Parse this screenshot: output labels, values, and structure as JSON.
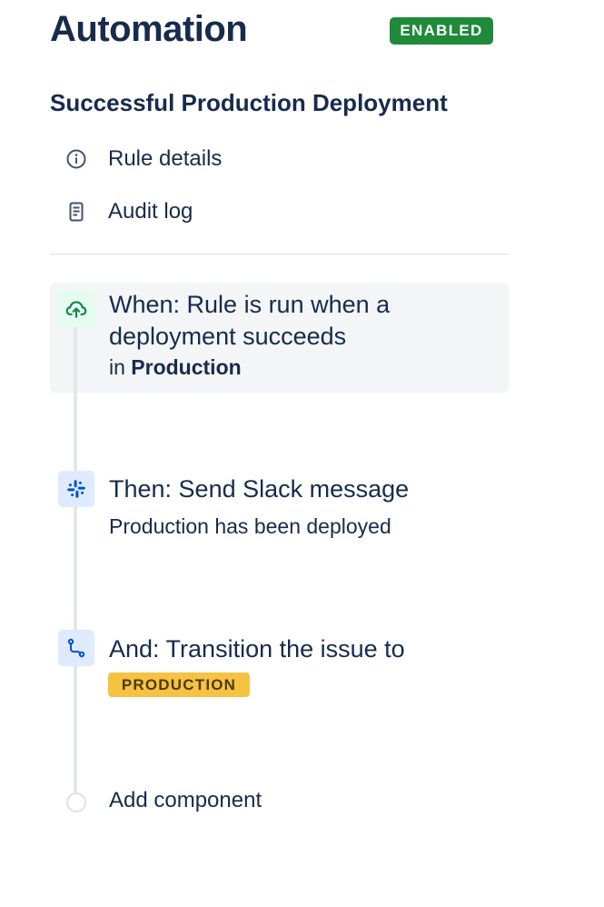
{
  "header": {
    "title": "Automation",
    "status_badge": "ENABLED"
  },
  "rule": {
    "name": "Successful Production Deployment"
  },
  "nav": [
    {
      "label": "Rule details",
      "icon": "info-icon"
    },
    {
      "label": "Audit log",
      "icon": "document-icon"
    }
  ],
  "trigger": {
    "line1": "When: Rule is run when a",
    "line2": "deployment succeeds",
    "env_prefix": "in",
    "env_name": "Production",
    "icon": "cloud-upload-icon"
  },
  "action_slack": {
    "title": "Then: Send Slack message",
    "detail": "Production has been deployed",
    "icon": "slack-icon"
  },
  "action_transition": {
    "title": "And: Transition the issue to",
    "status_lozenge": "PRODUCTION",
    "icon": "transition-icon"
  },
  "add_component": {
    "label": "Add component"
  },
  "colors": {
    "text": "#172b4d",
    "enabled_badge": "#1f8a3a",
    "lozenge": "#f6c242",
    "trigger_bg": "#f4f5f7"
  }
}
